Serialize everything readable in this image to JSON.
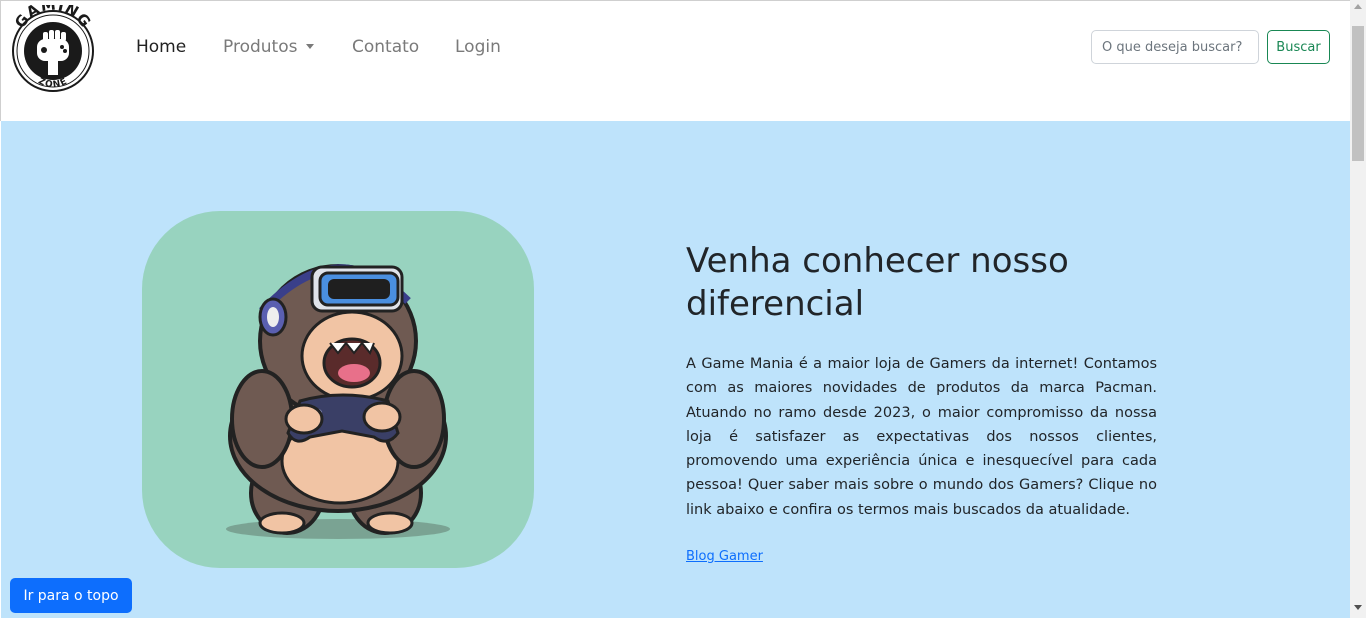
{
  "brand": {
    "logo_top_text": "GAMING",
    "logo_bottom_text": "ZONE",
    "logo_icon": "gamepad-fist-icon"
  },
  "nav": {
    "items": [
      {
        "label": "Home",
        "active": true
      },
      {
        "label": "Produtos",
        "dropdown": true
      },
      {
        "label": "Contato"
      },
      {
        "label": "Login"
      }
    ],
    "dropdown_icon": "caret-down-icon"
  },
  "search": {
    "placeholder": "O que deseja buscar?",
    "value": "",
    "button_label": "Buscar"
  },
  "hero": {
    "title": "Venha conhecer nosso diferencial",
    "paragraph": "A Game Mania é a maior loja de Gamers da internet! Contamos com as maiores novidades de produtos da marca Pacman. Atuando no ramo desde 2023, o maior compromisso da nossa loja é satisfazer as expectativas dos nossos clientes, promovendo uma experiência única e inesquecível para cada pessoa! Quer saber mais sobre o mundo dos Gamers? Clique no link abaixo e confira os termos mais buscados da atualidade.",
    "link_label": "Blog Gamer",
    "image_icon": "gorilla-vr-gamer-illustration"
  },
  "back_to_top": {
    "label": "Ir para o topo"
  },
  "colors": {
    "hero_bg": "#bee3fb",
    "image_bg": "#98d3bf",
    "primary": "#0d6efd",
    "success": "#198754",
    "text": "#212529",
    "nav_muted": "#7a7a7a"
  }
}
